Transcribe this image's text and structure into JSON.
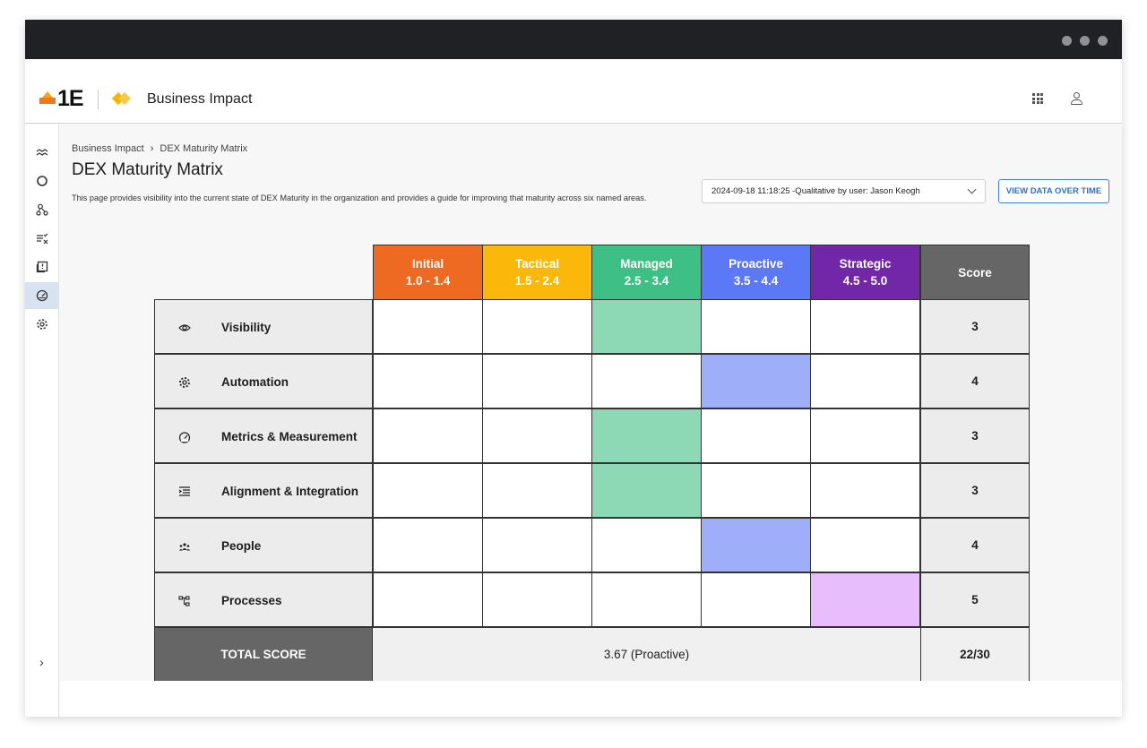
{
  "app": {
    "title": "Business Impact",
    "logo_text": "1E"
  },
  "sidebar": {
    "items": [
      {
        "icon": "trend-icon"
      },
      {
        "icon": "circle-icon"
      },
      {
        "icon": "nodes-icon"
      },
      {
        "icon": "checklist-icon"
      },
      {
        "icon": "book-icon"
      },
      {
        "icon": "gauge-icon",
        "active": true
      },
      {
        "icon": "settings-icon"
      }
    ],
    "expand_label": "›"
  },
  "breadcrumb": {
    "items": [
      "Business Impact",
      "DEX Maturity Matrix"
    ],
    "separator": "›"
  },
  "page": {
    "title": "DEX Maturity Matrix",
    "description": "This page provides visibility into the current state of DEX Maturity in the organization and provides a guide for improving that maturity across six named areas."
  },
  "snapshot_select": {
    "value": "2024-09-18 11:18:25 -Qualitative by user: Jason Keogh"
  },
  "view_button": {
    "label": "VIEW DATA OVER TIME"
  },
  "matrix": {
    "levels": [
      {
        "name": "Initial",
        "range": "1.0 - 1.4",
        "color": "#ee6a22",
        "fill": "#ee6a22"
      },
      {
        "name": "Tactical",
        "range": "1.5 - 2.4",
        "color": "#fbb80b",
        "fill": "#fbb80b"
      },
      {
        "name": "Managed",
        "range": "2.5 - 3.4",
        "color": "#3ebf85",
        "fill": "#8dd9b6"
      },
      {
        "name": "Proactive",
        "range": "3.5 - 4.4",
        "color": "#5b78f6",
        "fill": "#9eaef8"
      },
      {
        "name": "Strategic",
        "range": "4.5 - 5.0",
        "color": "#7227a8",
        "fill": "#e8bdfb"
      }
    ],
    "score_header": "Score",
    "score_header_color": "#666666",
    "rows": [
      {
        "name": "Visibility",
        "icon": "eye-icon",
        "level_index": 2,
        "score": "3"
      },
      {
        "name": "Automation",
        "icon": "gear-icon",
        "level_index": 3,
        "score": "4"
      },
      {
        "name": "Metrics & Measurement",
        "icon": "gauge-icon",
        "level_index": 2,
        "score": "3"
      },
      {
        "name": "Alignment & Integration",
        "icon": "indent-icon",
        "level_index": 2,
        "score": "3"
      },
      {
        "name": "People",
        "icon": "people-icon",
        "level_index": 3,
        "score": "4"
      },
      {
        "name": "Processes",
        "icon": "flow-icon",
        "level_index": 4,
        "score": "5"
      }
    ],
    "total": {
      "label": "TOTAL SCORE",
      "value": "3.67 (Proactive)",
      "score": "22/30"
    }
  }
}
